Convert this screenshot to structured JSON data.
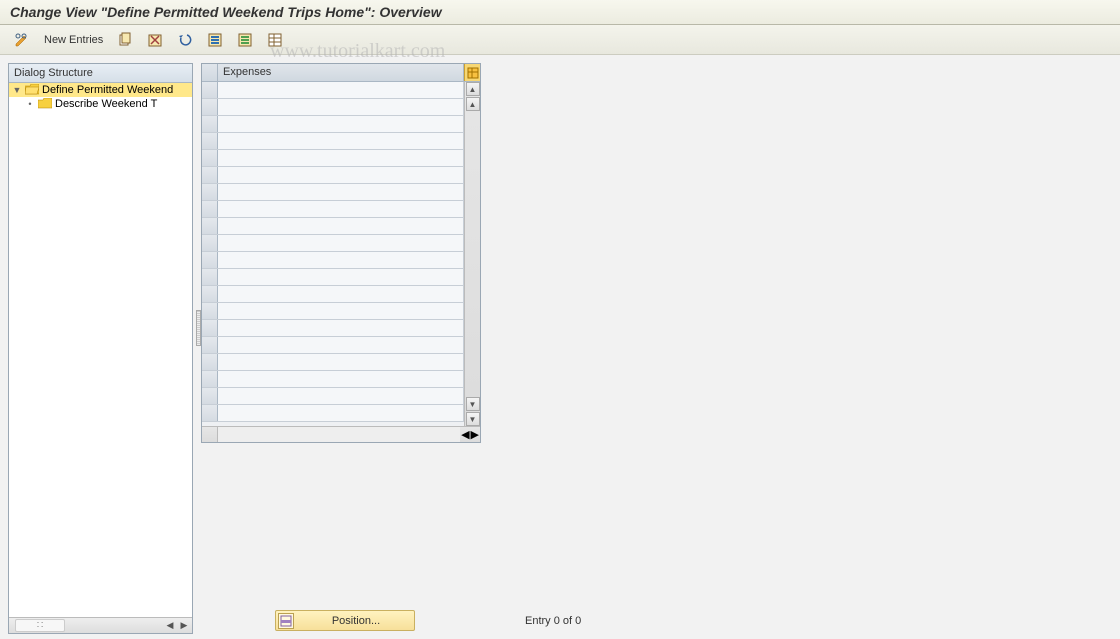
{
  "title": "Change View \"Define Permitted Weekend Trips Home\": Overview",
  "watermark": "www.tutorialkart.com",
  "toolbar": {
    "new_entries_label": "New Entries"
  },
  "dialog_structure": {
    "header": "Dialog Structure",
    "items": [
      {
        "label": "Define Permitted Weekend",
        "selected": true,
        "open": true,
        "level": 0
      },
      {
        "label": "Describe Weekend T",
        "selected": false,
        "open": false,
        "level": 1
      }
    ]
  },
  "table": {
    "column_header": "Expenses",
    "row_count": 20
  },
  "footer": {
    "position_label": "Position...",
    "entry_text": "Entry 0 of 0"
  }
}
